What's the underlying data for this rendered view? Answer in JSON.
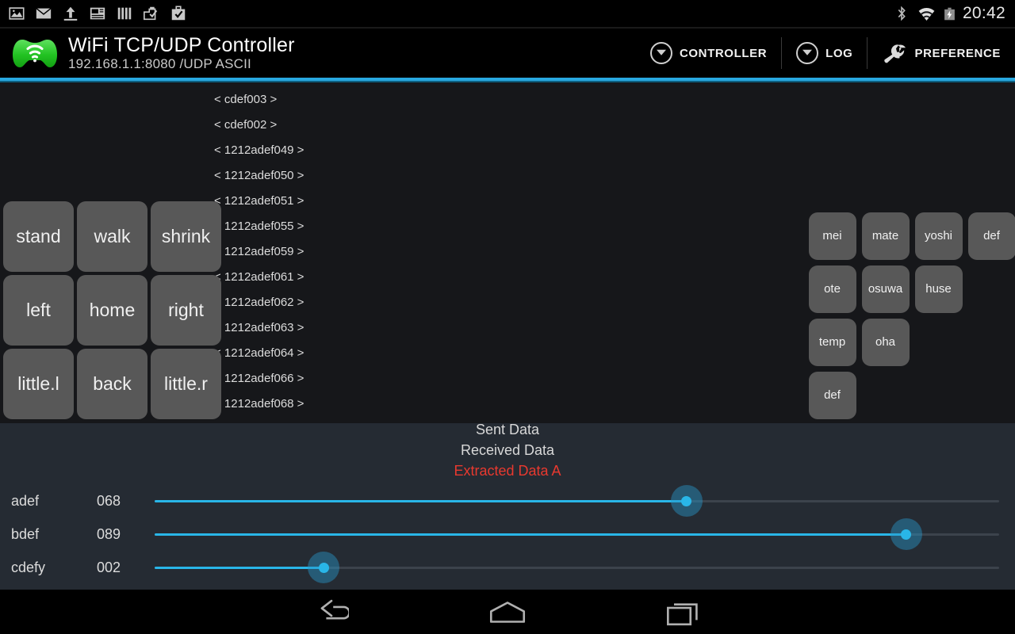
{
  "statusbar": {
    "icons": [
      "image-icon",
      "mail-icon",
      "upload-icon",
      "news-icon",
      "equalizer-icon",
      "clipboard-check-icon",
      "briefcase-check-icon"
    ],
    "right_icons": [
      "bluetooth-icon",
      "wifi-icon",
      "battery-charging-icon"
    ],
    "clock": "20:42"
  },
  "actionbar": {
    "logo_icon": "gamepad-wifi-logo",
    "title": "WiFi TCP/UDP Controller",
    "subtitle": "192.168.1.1:8080 /UDP  ASCII",
    "actions": [
      {
        "label": "CONTROLLER",
        "icon": "chevron-down-circle-icon"
      },
      {
        "label": "LOG",
        "icon": "chevron-down-circle-icon"
      },
      {
        "label": "PREFERENCE",
        "icon": "wrench-icon"
      }
    ],
    "accent_color": "#28a8e0"
  },
  "log": {
    "lines": [
      "< cdef003 >",
      "< cdef002 >",
      "< 1212adef049 >",
      "< 1212adef050 >",
      "< 1212adef051 >",
      "< 1212adef055 >",
      "< 1212adef059 >",
      "< 1212adef061 >",
      "< 1212adef062 >",
      "< 1212adef063 >",
      "< 1212adef064 >",
      "< 1212adef066 >",
      "< 1212adef068 >"
    ]
  },
  "left_buttons": [
    "stand",
    "walk",
    "shrink",
    "left",
    "home",
    "right",
    "little.l",
    "back",
    "little.r"
  ],
  "right_buttons": [
    "mei",
    "mate",
    "yoshi",
    "def",
    "ote",
    "osuwa",
    "huse",
    "",
    "temp",
    "oha",
    "",
    "",
    "def",
    "",
    "",
    ""
  ],
  "center_labels": {
    "sent": "Sent Data",
    "received": "Received Data",
    "extracted": "Extracted Data A",
    "extracted_color": "#e8392f"
  },
  "sliders": [
    {
      "name": "adef",
      "value": "068",
      "percent": 63,
      "track_color": "#29b6e8"
    },
    {
      "name": "bdef",
      "value": "089",
      "percent": 89,
      "track_color": "#29b6e8"
    },
    {
      "name": "cdefy",
      "value": "002",
      "percent": 20,
      "track_color": "#29b6e8"
    }
  ],
  "navbar": {
    "back": "back-icon",
    "home": "home-icon",
    "recents": "recents-icon"
  }
}
